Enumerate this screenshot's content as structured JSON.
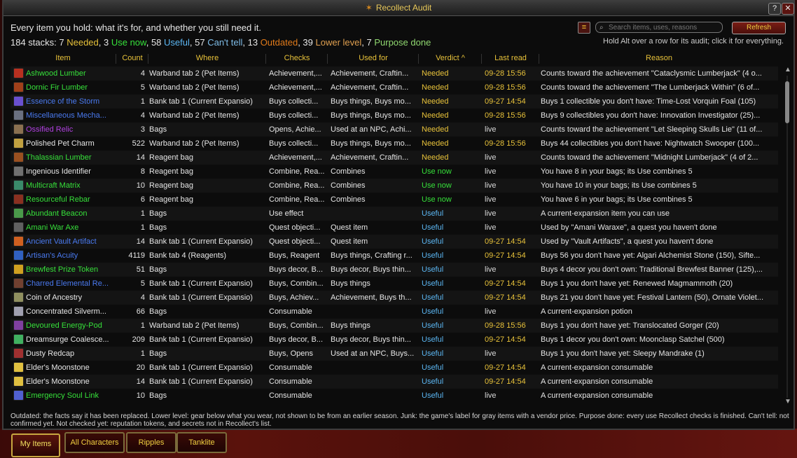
{
  "window": {
    "title": "Recollect Audit",
    "title_icon": "✶",
    "help_label": "?",
    "close_label": "✕"
  },
  "summary": {
    "line1": "Every item you hold: what it's for, and whether you still need it.",
    "total": "184 stacks: ",
    "needed_n": "7 ",
    "needed": "Needed",
    "sep1": ", ",
    "usenow_n": "3 ",
    "usenow": "Use now",
    "sep2": ", ",
    "useful_n": "58 ",
    "useful": "Useful",
    "sep3": ", ",
    "canttell_n": "57 ",
    "canttell": "Can't tell",
    "sep4": ", ",
    "outdated_n": "13 ",
    "outdated": "Outdated",
    "sep5": ", ",
    "lower_n": "39 ",
    "lower": "Lower level",
    "sep6": ", ",
    "purpose_n": "7 ",
    "purpose": "Purpose done"
  },
  "toolbar": {
    "filter_icon": "≡",
    "search_placeholder": "Search items, uses, reasons",
    "refresh_label": "Refresh",
    "hint": "Hold Alt over a row for its audit; click it for everything."
  },
  "columns": {
    "item": "Item",
    "count": "Count",
    "where": "Where",
    "checks": "Checks",
    "usedfor": "Used for",
    "verdict": "Verdict ^",
    "lastread": "Last read",
    "reason": "Reason"
  },
  "colors": {
    "needed": "#e8c23a",
    "usenow": "#36e03a",
    "useful": "#5bb6f2",
    "timestamp": "#e8c23a",
    "live": "#d8d8d8"
  },
  "rows": [
    {
      "name": "Ashwood Lumber",
      "nameColor": "#36e03a",
      "iconColor": "#b83020",
      "count": "4",
      "where": "Warband tab 2 (Pet Items)",
      "checks": "Achievement,...",
      "usedfor": "Achievement, Craftin...",
      "verdict": "Needed",
      "verdictColor": "#e8c23a",
      "lastread": "09-28 15:56",
      "lastColor": "#e8c23a",
      "reason": "Counts toward the achievement \"Cataclysmic Lumberjack\" (4 o..."
    },
    {
      "name": "Dornic Fir Lumber",
      "nameColor": "#36e03a",
      "iconColor": "#a0401a",
      "count": "5",
      "where": "Warband tab 2 (Pet Items)",
      "checks": "Achievement,...",
      "usedfor": "Achievement, Craftin...",
      "verdict": "Needed",
      "verdictColor": "#e8c23a",
      "lastread": "09-28 15:56",
      "lastColor": "#e8c23a",
      "reason": "Counts toward the achievement \"The Lumberjack Within\" (6 of..."
    },
    {
      "name": "Essence of the Storm",
      "nameColor": "#4a7af0",
      "iconColor": "#6a50d0",
      "count": "1",
      "where": "Bank tab 1 (Current Expansio)",
      "checks": "Buys collecti...",
      "usedfor": "Buys things, Buys mo...",
      "verdict": "Needed",
      "verdictColor": "#e8c23a",
      "lastread": "09-27 14:54",
      "lastColor": "#e8c23a",
      "reason": "Buys 1 collectible you don't have: Time-Lost Vorquin Foal (105)"
    },
    {
      "name": "Miscellaneous Mecha...",
      "nameColor": "#4a7af0",
      "iconColor": "#6a7080",
      "count": "4",
      "where": "Warband tab 2 (Pet Items)",
      "checks": "Buys collecti...",
      "usedfor": "Buys things, Buys mo...",
      "verdict": "Needed",
      "verdictColor": "#e8c23a",
      "lastread": "09-28 15:56",
      "lastColor": "#e8c23a",
      "reason": "Buys 9 collectibles you don't have: Innovation Investigator (25)..."
    },
    {
      "name": "Ossified Relic",
      "nameColor": "#b040e0",
      "iconColor": "#8a7050",
      "count": "3",
      "where": "Bags",
      "checks": "Opens, Achie...",
      "usedfor": "Used at an NPC, Achi...",
      "verdict": "Needed",
      "verdictColor": "#e8c23a",
      "lastread": "live",
      "lastColor": "#d8d8d8",
      "reason": "Counts toward the achievement \"Let Sleeping Skulls Lie\" (11 of..."
    },
    {
      "name": "Polished Pet Charm",
      "nameColor": "#e6e6e6",
      "iconColor": "#c0a040",
      "count": "522",
      "where": "Warband tab 2 (Pet Items)",
      "checks": "Buys collecti...",
      "usedfor": "Buys things, Buys mo...",
      "verdict": "Needed",
      "verdictColor": "#e8c23a",
      "lastread": "09-28 15:56",
      "lastColor": "#e8c23a",
      "reason": "Buys 44 collectibles you don't have: Nightwatch Swooper (100..."
    },
    {
      "name": "Thalassian Lumber",
      "nameColor": "#36e03a",
      "iconColor": "#9a5020",
      "count": "14",
      "where": "Reagent bag",
      "checks": "Achievement,...",
      "usedfor": "Achievement, Craftin...",
      "verdict": "Needed",
      "verdictColor": "#e8c23a",
      "lastread": "live",
      "lastColor": "#d8d8d8",
      "reason": "Counts toward the achievement \"Midnight Lumberjack\" (4 of 2..."
    },
    {
      "name": "Ingenious Identifier",
      "nameColor": "#e6e6e6",
      "iconColor": "#707070",
      "count": "8",
      "where": "Reagent bag",
      "checks": "Combine, Rea...",
      "usedfor": "Combines",
      "verdict": "Use now",
      "verdictColor": "#36e03a",
      "lastread": "live",
      "lastColor": "#d8d8d8",
      "reason": "You have 8 in your bags; its Use combines 5"
    },
    {
      "name": "Multicraft Matrix",
      "nameColor": "#36e03a",
      "iconColor": "#3a8a6a",
      "count": "10",
      "where": "Reagent bag",
      "checks": "Combine, Rea...",
      "usedfor": "Combines",
      "verdict": "Use now",
      "verdictColor": "#36e03a",
      "lastread": "live",
      "lastColor": "#d8d8d8",
      "reason": "You have 10 in your bags; its Use combines 5"
    },
    {
      "name": "Resourceful Rebar",
      "nameColor": "#36e03a",
      "iconColor": "#8a3020",
      "count": "6",
      "where": "Reagent bag",
      "checks": "Combine, Rea...",
      "usedfor": "Combines",
      "verdict": "Use now",
      "verdictColor": "#36e03a",
      "lastread": "live",
      "lastColor": "#d8d8d8",
      "reason": "You have 6 in your bags; its Use combines 5"
    },
    {
      "name": "Abundant Beacon",
      "nameColor": "#36e03a",
      "iconColor": "#4a9a4a",
      "count": "1",
      "where": "Bags",
      "checks": "Use effect",
      "usedfor": "",
      "verdict": "Useful",
      "verdictColor": "#5bb6f2",
      "lastread": "live",
      "lastColor": "#d8d8d8",
      "reason": "A current-expansion item you can use"
    },
    {
      "name": "Amani War Axe",
      "nameColor": "#36e03a",
      "iconColor": "#606060",
      "count": "1",
      "where": "Bags",
      "checks": "Quest objecti...",
      "usedfor": "Quest item",
      "verdict": "Useful",
      "verdictColor": "#5bb6f2",
      "lastread": "live",
      "lastColor": "#d8d8d8",
      "reason": "Used by \"Amani Waraxe\", a quest you haven't done"
    },
    {
      "name": "Ancient Vault Artifact",
      "nameColor": "#4a7af0",
      "iconColor": "#d06020",
      "count": "14",
      "where": "Bank tab 1 (Current Expansio)",
      "checks": "Quest objecti...",
      "usedfor": "Quest item",
      "verdict": "Useful",
      "verdictColor": "#5bb6f2",
      "lastread": "09-27 14:54",
      "lastColor": "#e8c23a",
      "reason": "Used by \"Vault Artifacts\", a quest you haven't done"
    },
    {
      "name": "Artisan's Acuity",
      "nameColor": "#4a7af0",
      "iconColor": "#3060c0",
      "count": "4119",
      "where": "Bank tab 4 (Reagents)",
      "checks": "Buys, Reagent",
      "usedfor": "Buys things, Crafting r...",
      "verdict": "Useful",
      "verdictColor": "#5bb6f2",
      "lastread": "09-27 14:54",
      "lastColor": "#e8c23a",
      "reason": "Buys 56 you don't have yet: Algari Alchemist Stone (150), Sifte..."
    },
    {
      "name": "Brewfest Prize Token",
      "nameColor": "#36e03a",
      "iconColor": "#d0a020",
      "count": "51",
      "where": "Bags",
      "checks": "Buys decor, B...",
      "usedfor": "Buys decor, Buys thin...",
      "verdict": "Useful",
      "verdictColor": "#5bb6f2",
      "lastread": "live",
      "lastColor": "#d8d8d8",
      "reason": "Buys 4 decor you don't own: Traditional Brewfest Banner (125),..."
    },
    {
      "name": "Charred Elemental Re...",
      "nameColor": "#4a7af0",
      "iconColor": "#704030",
      "count": "5",
      "where": "Bank tab 1 (Current Expansio)",
      "checks": "Buys, Combin...",
      "usedfor": "Buys things",
      "verdict": "Useful",
      "verdictColor": "#5bb6f2",
      "lastread": "09-27 14:54",
      "lastColor": "#e8c23a",
      "reason": "Buys 1 you don't have yet: Renewed Magmammoth (20)"
    },
    {
      "name": "Coin of Ancestry",
      "nameColor": "#e6e6e6",
      "iconColor": "#909060",
      "count": "4",
      "where": "Bank tab 1 (Current Expansio)",
      "checks": "Buys, Achiev...",
      "usedfor": "Achievement, Buys th...",
      "verdict": "Useful",
      "verdictColor": "#5bb6f2",
      "lastread": "09-27 14:54",
      "lastColor": "#e8c23a",
      "reason": "Buys 21 you don't have yet: Festival Lantern (50), Ornate Violet..."
    },
    {
      "name": "Concentrated Silverm...",
      "nameColor": "#e6e6e6",
      "iconColor": "#a0a0b0",
      "count": "66",
      "where": "Bags",
      "checks": "Consumable",
      "usedfor": "",
      "verdict": "Useful",
      "verdictColor": "#5bb6f2",
      "lastread": "live",
      "lastColor": "#d8d8d8",
      "reason": "A current-expansion potion"
    },
    {
      "name": "Devoured Energy-Pod",
      "nameColor": "#36e03a",
      "iconColor": "#8040a0",
      "count": "1",
      "where": "Warband tab 2 (Pet Items)",
      "checks": "Buys, Combin...",
      "usedfor": "Buys things",
      "verdict": "Useful",
      "verdictColor": "#5bb6f2",
      "lastread": "09-28 15:56",
      "lastColor": "#e8c23a",
      "reason": "Buys 1 you don't have yet: Translocated Gorger (20)"
    },
    {
      "name": "Dreamsurge Coalesce...",
      "nameColor": "#e6e6e6",
      "iconColor": "#40b060",
      "count": "209",
      "where": "Bank tab 1 (Current Expansio)",
      "checks": "Buys decor, B...",
      "usedfor": "Buys decor, Buys thin...",
      "verdict": "Useful",
      "verdictColor": "#5bb6f2",
      "lastread": "09-27 14:54",
      "lastColor": "#e8c23a",
      "reason": "Buys 1 decor you don't own: Moonclasp Satchel (500)"
    },
    {
      "name": "Dusty Redcap",
      "nameColor": "#e6e6e6",
      "iconColor": "#a03030",
      "count": "1",
      "where": "Bags",
      "checks": "Buys, Opens",
      "usedfor": "Used at an NPC, Buys...",
      "verdict": "Useful",
      "verdictColor": "#5bb6f2",
      "lastread": "live",
      "lastColor": "#d8d8d8",
      "reason": "Buys 1 you don't have yet: Sleepy Mandrake (1)"
    },
    {
      "name": "Elder's Moonstone",
      "nameColor": "#e6e6e6",
      "iconColor": "#e0c040",
      "count": "20",
      "where": "Bank tab 1 (Current Expansio)",
      "checks": "Consumable",
      "usedfor": "",
      "verdict": "Useful",
      "verdictColor": "#5bb6f2",
      "lastread": "09-27 14:54",
      "lastColor": "#e8c23a",
      "reason": "A current-expansion consumable"
    },
    {
      "name": "Elder's Moonstone",
      "nameColor": "#e6e6e6",
      "iconColor": "#e0c040",
      "count": "14",
      "where": "Bank tab 1 (Current Expansio)",
      "checks": "Consumable",
      "usedfor": "",
      "verdict": "Useful",
      "verdictColor": "#5bb6f2",
      "lastread": "09-27 14:54",
      "lastColor": "#e8c23a",
      "reason": "A current-expansion consumable"
    },
    {
      "name": "Emergency Soul Link",
      "nameColor": "#36e03a",
      "iconColor": "#5060d0",
      "count": "10",
      "where": "Bags",
      "checks": "Consumable",
      "usedfor": "",
      "verdict": "Useful",
      "verdictColor": "#5bb6f2",
      "lastread": "live",
      "lastColor": "#d8d8d8",
      "reason": "A current-expansion consumable"
    }
  ],
  "footer": {
    "text": "Outdated: the facts say it has been replaced. Lower level: gear below what you wear, not shown to be from an earlier season. Junk: the game's label for gray items with a vendor price. Purpose done: every use Recollect checks is finished. Can't tell: not confirmed yet. Not checked yet: reputation tokens, and secrets not in Recollect's list."
  },
  "tabs": [
    {
      "label": "My Items",
      "active": true
    },
    {
      "label": "All Characters",
      "active": false
    },
    {
      "label": "Ripples",
      "active": false
    },
    {
      "label": "Tanklite",
      "active": false
    }
  ]
}
